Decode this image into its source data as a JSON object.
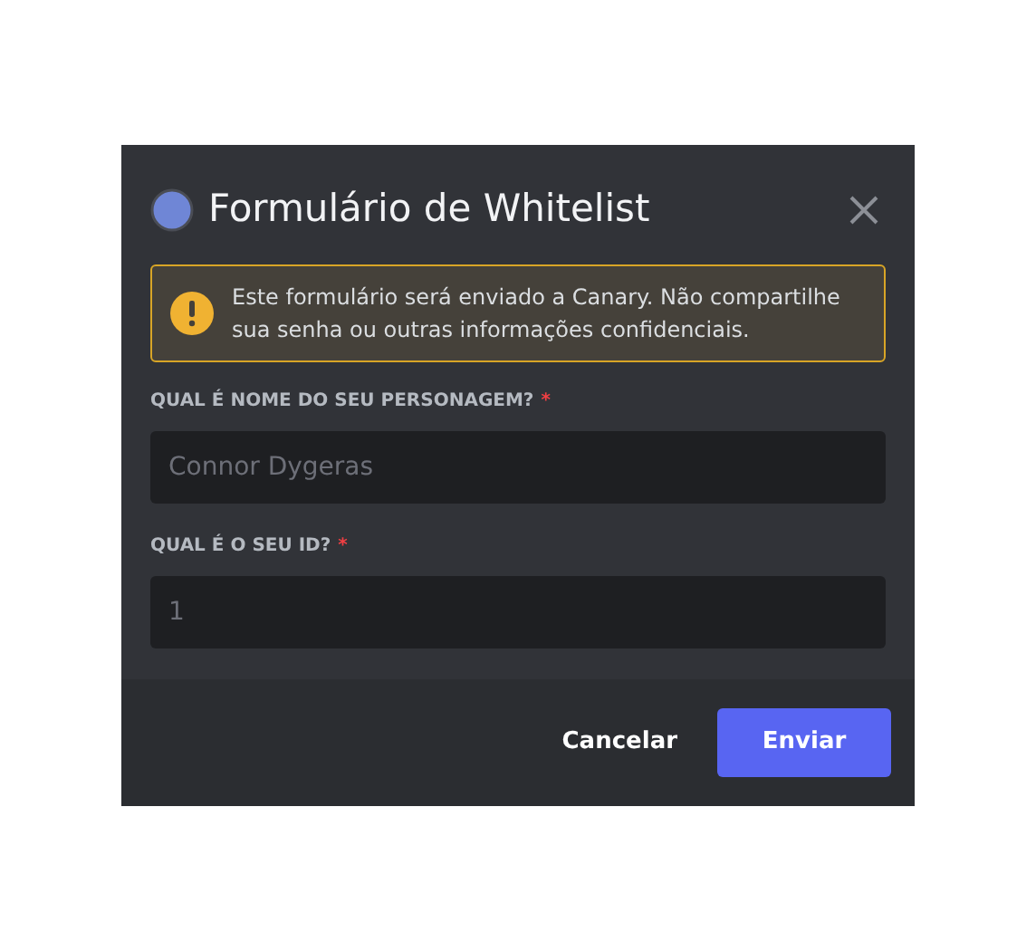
{
  "dialog": {
    "title": "Formulário de Whitelist",
    "notice": "Este formulário será enviado a Canary. Não compartilhe sua senha ou outras informações confidenciais.",
    "fields": [
      {
        "label": "QUAL É NOME DO SEU PERSONAGEM?",
        "required_mark": "*",
        "placeholder": "Connor Dygeras"
      },
      {
        "label": "QUAL É O SEU ID?",
        "required_mark": "*",
        "placeholder": "1"
      }
    ],
    "buttons": [
      {
        "label": "Cancelar",
        "kind": "link"
      },
      {
        "label": "Enviar",
        "kind": "primary"
      }
    ]
  }
}
